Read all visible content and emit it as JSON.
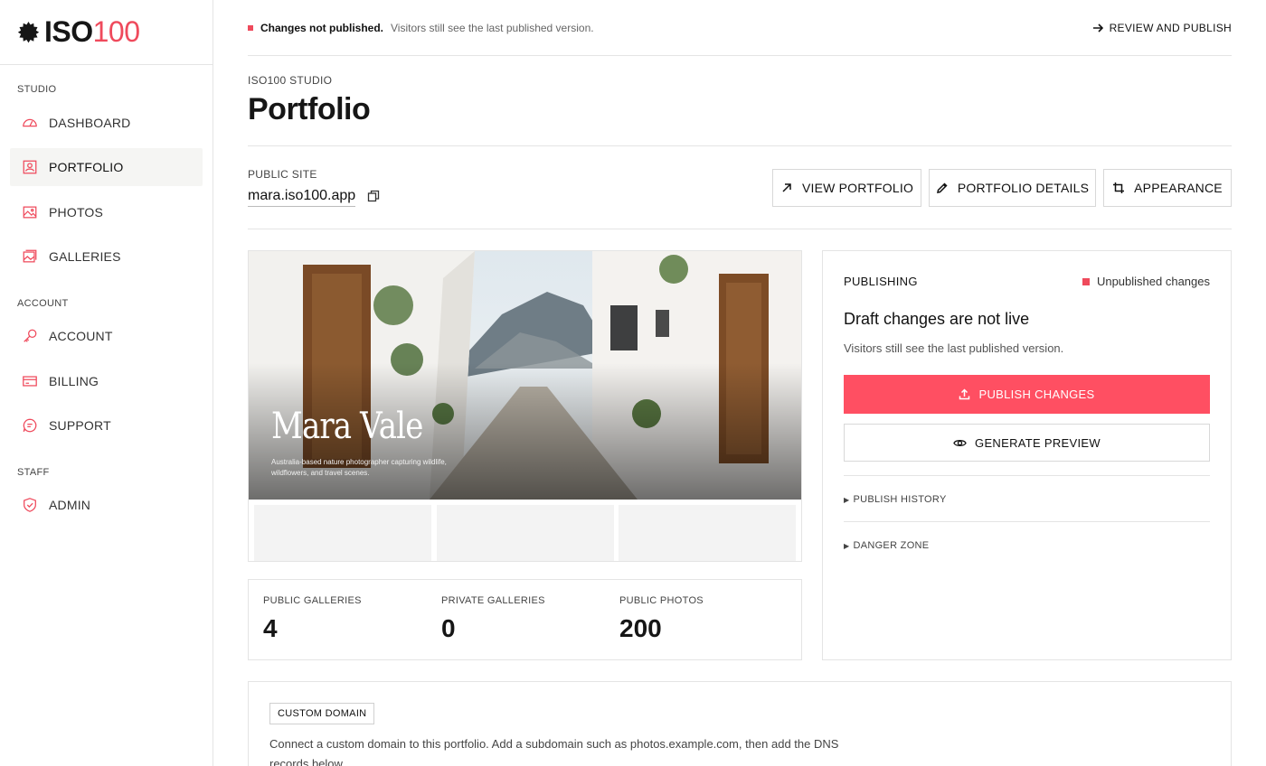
{
  "brand": {
    "logo_bold": "ISO",
    "logo_accent": "100"
  },
  "sidebar": {
    "sections": [
      {
        "label": "STUDIO"
      },
      {
        "label": "ACCOUNT"
      },
      {
        "label": "STAFF"
      }
    ],
    "items": [
      {
        "label": "DASHBOARD",
        "icon": "dashboard-icon"
      },
      {
        "label": "PORTFOLIO",
        "icon": "portfolio-icon",
        "active": true
      },
      {
        "label": "PHOTOS",
        "icon": "photo-icon"
      },
      {
        "label": "GALLERIES",
        "icon": "galleries-icon"
      },
      {
        "label": "ACCOUNT",
        "icon": "key-icon"
      },
      {
        "label": "BILLING",
        "icon": "credit-card-icon"
      },
      {
        "label": "SUPPORT",
        "icon": "chat-icon"
      },
      {
        "label": "ADMIN",
        "icon": "shield-check-icon"
      }
    ]
  },
  "banner": {
    "strong": "Changes not published.",
    "muted": "Visitors still see the last published version.",
    "action": "REVIEW AND PUBLISH"
  },
  "header": {
    "breadcrumb": "ISO100 STUDIO",
    "title": "Portfolio"
  },
  "site": {
    "label": "PUBLIC SITE",
    "url": "mara.iso100.app",
    "buttons": {
      "view": "VIEW PORTFOLIO",
      "details": "PORTFOLIO DETAILS",
      "appearance": "APPEARANCE"
    }
  },
  "preview": {
    "name": "Mara Vale",
    "description": "Australia-based nature photographer capturing wildlife, wildflowers, and travel scenes."
  },
  "stats": [
    {
      "label": "PUBLIC GALLERIES",
      "value": "4"
    },
    {
      "label": "PRIVATE GALLERIES",
      "value": "0"
    },
    {
      "label": "PUBLIC PHOTOS",
      "value": "200"
    }
  ],
  "publishing": {
    "heading": "PUBLISHING",
    "status": "Unpublished changes",
    "title": "Draft changes are not live",
    "subtitle": "Visitors still see the last published version.",
    "publish_button": "PUBLISH CHANGES",
    "preview_button": "GENERATE PREVIEW",
    "history": "PUBLISH HISTORY",
    "danger": "DANGER ZONE"
  },
  "domain": {
    "tag": "CUSTOM DOMAIN",
    "description": "Connect a custom domain to this portfolio. Add a subdomain such as photos.example.com, then add the DNS records below."
  },
  "colors": {
    "accent": "#ef4a5c",
    "primary_button": "#ff4f62",
    "border": "#e4e4e4"
  }
}
